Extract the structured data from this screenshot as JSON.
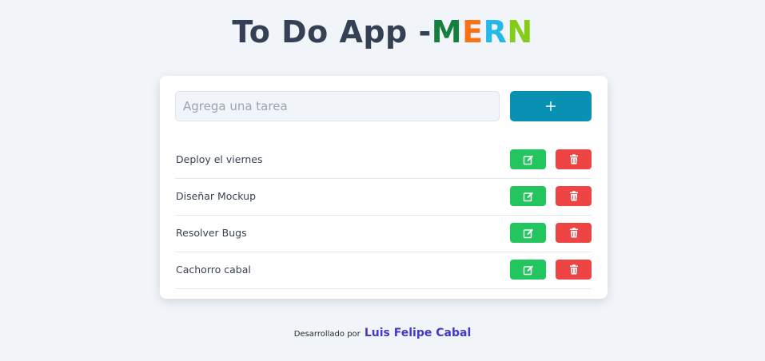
{
  "header": {
    "title_prefix": "To Do App -",
    "title_letters": [
      "M",
      "E",
      "R",
      "N"
    ]
  },
  "form": {
    "input_placeholder": "Agrega una tarea",
    "input_value": "",
    "add_icon": "plus-icon"
  },
  "tasks": [
    {
      "label": "Deploy el viernes"
    },
    {
      "label": "Diseñar Mockup"
    },
    {
      "label": "Resolver Bugs"
    },
    {
      "label": "Cachorro cabal"
    }
  ],
  "task_actions": {
    "edit_icon": "edit-icon",
    "delete_icon": "trash-icon"
  },
  "footer": {
    "prefix": "Desarrollado por",
    "author": "Luis Felipe Cabal"
  },
  "colors": {
    "background": "#f1f4f8",
    "title": "#344054",
    "add_button": "#0891b2",
    "edit_button": "#22c55e",
    "delete_button": "#ef4444",
    "author_link": "#4338ca",
    "mern_m": "#15803d",
    "mern_e": "#f97316",
    "mern_r": "#22b8e8",
    "mern_n": "#84cc16"
  }
}
